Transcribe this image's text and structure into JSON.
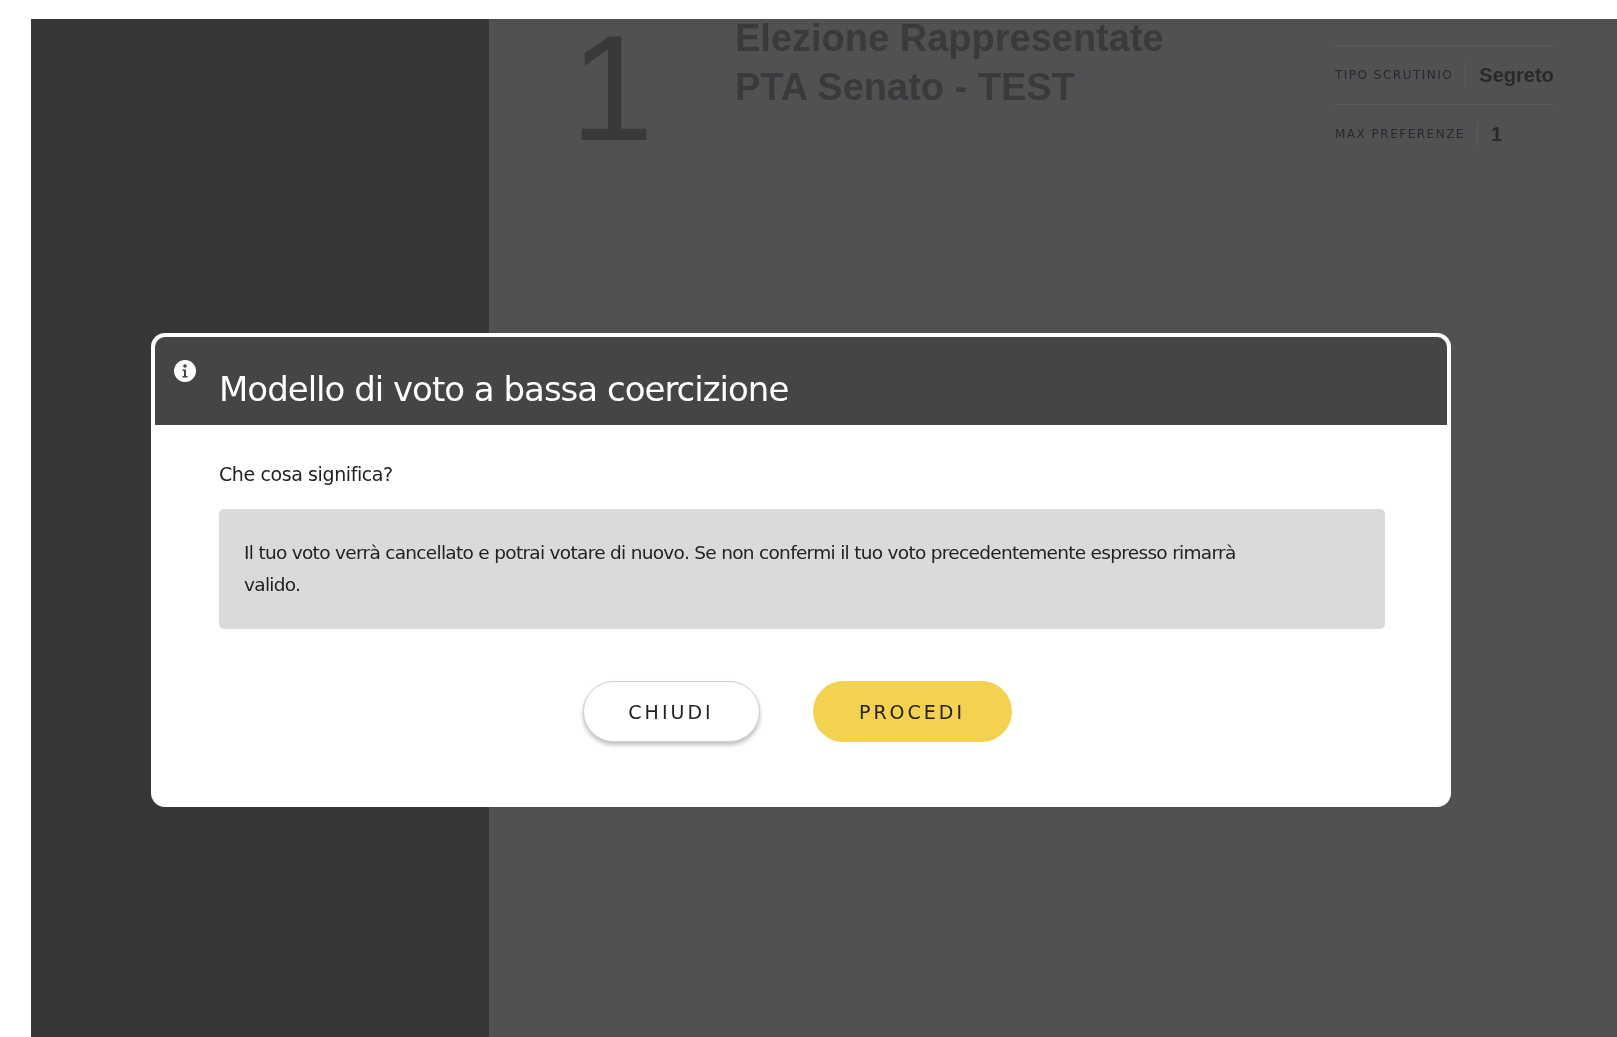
{
  "election": {
    "number": "1",
    "title_lines": [
      "Elezione Rappresentate",
      "PTA Senato - TEST"
    ],
    "details": [
      {
        "label": "TIPO SCRUTINIO",
        "value": "Segreto"
      },
      {
        "label": "MAX PREFERENZE",
        "value": "1"
      }
    ]
  },
  "dialog": {
    "title": "Modello di voto a bassa coercizione",
    "question": "Che cosa significa?",
    "explanation": "Il tuo voto verrà cancellato e potrai votare di nuovo. Se non confermi il tuo voto precedentemente espresso rimarrà valido.",
    "buttons": [
      {
        "label": "CHIUDI",
        "kind": "secondary"
      },
      {
        "label": "PROCEDI",
        "kind": "primary"
      }
    ]
  }
}
